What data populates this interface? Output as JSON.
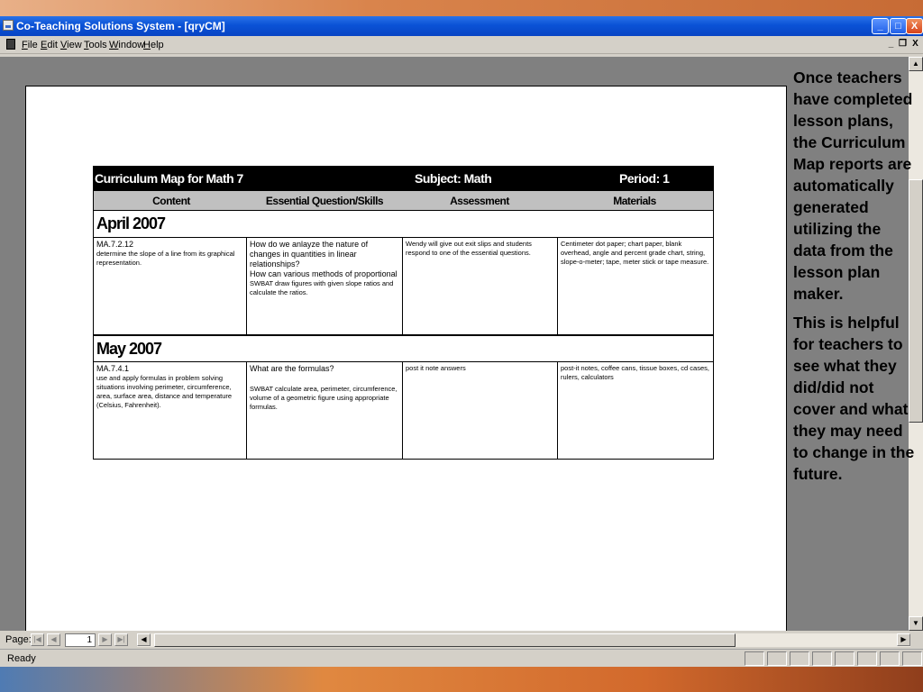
{
  "window": {
    "title": "Co-Teaching Solutions System - [qryCM]",
    "controls": {
      "minimize": "_",
      "maximize": "□",
      "close": "X"
    }
  },
  "menu": {
    "items": [
      "File",
      "Edit",
      "View",
      "Tools",
      "Window",
      "Help"
    ],
    "mdi_controls": {
      "minimize": "_",
      "restore": "❐",
      "close": "X"
    }
  },
  "report": {
    "title": "Curriculum Map for  Math 7",
    "subject": "Subject: Math",
    "period": "Period: 1",
    "columns": [
      "Content",
      "Essential Question/Skills",
      "Assessment",
      "Materials"
    ],
    "months": [
      {
        "label": "April 2007",
        "row": {
          "content_code": "MA.7.2.12",
          "content_desc": "determine the slope of a line from its graphical representation.",
          "question": "How do we anlayze the nature of changes in quantities in linear relationships?",
          "question2": "How can various methods of proportional",
          "skills": "SWBAT draw figures with given slope ratios and calculate the ratios.",
          "assessment": "Wendy will give out exit slips and students respond to one of the essential questions.",
          "materials": "Centimeter dot paper; chart paper, blank overhead, angle and percent grade chart, string, slope-o-meter; tape, meter stick or tape measure."
        }
      },
      {
        "label": "May 2007",
        "row": {
          "content_code": "MA.7.4.1",
          "content_desc": "use and apply formulas in problem solving situations involving perimeter, circumference, area, surface area, distance and temperature (Celsius, Fahrenheit).",
          "question": "What are the formulas?",
          "question2": "",
          "skills": "SWBAT calculate area, perimeter, circumference, volume of a geometric figure using appropriate formulas.",
          "assessment": "post it note answers",
          "materials": "post-it notes, coffee cans, tissue boxes, cd cases, rulers, calculators"
        }
      }
    ]
  },
  "side_note": {
    "paragraph1": "Once teachers have completed lesson plans, the Curriculum Map reports are automatically generated utilizing the data from the lesson plan maker.",
    "paragraph2": "This is helpful for teachers to see what they did/did not cover and what they may need to change in the future."
  },
  "navigation": {
    "label": "Page:",
    "page_value": "1",
    "first": "|◀",
    "prev": "◀",
    "next": "▶",
    "last": "▶|"
  },
  "status": {
    "text": "Ready"
  }
}
